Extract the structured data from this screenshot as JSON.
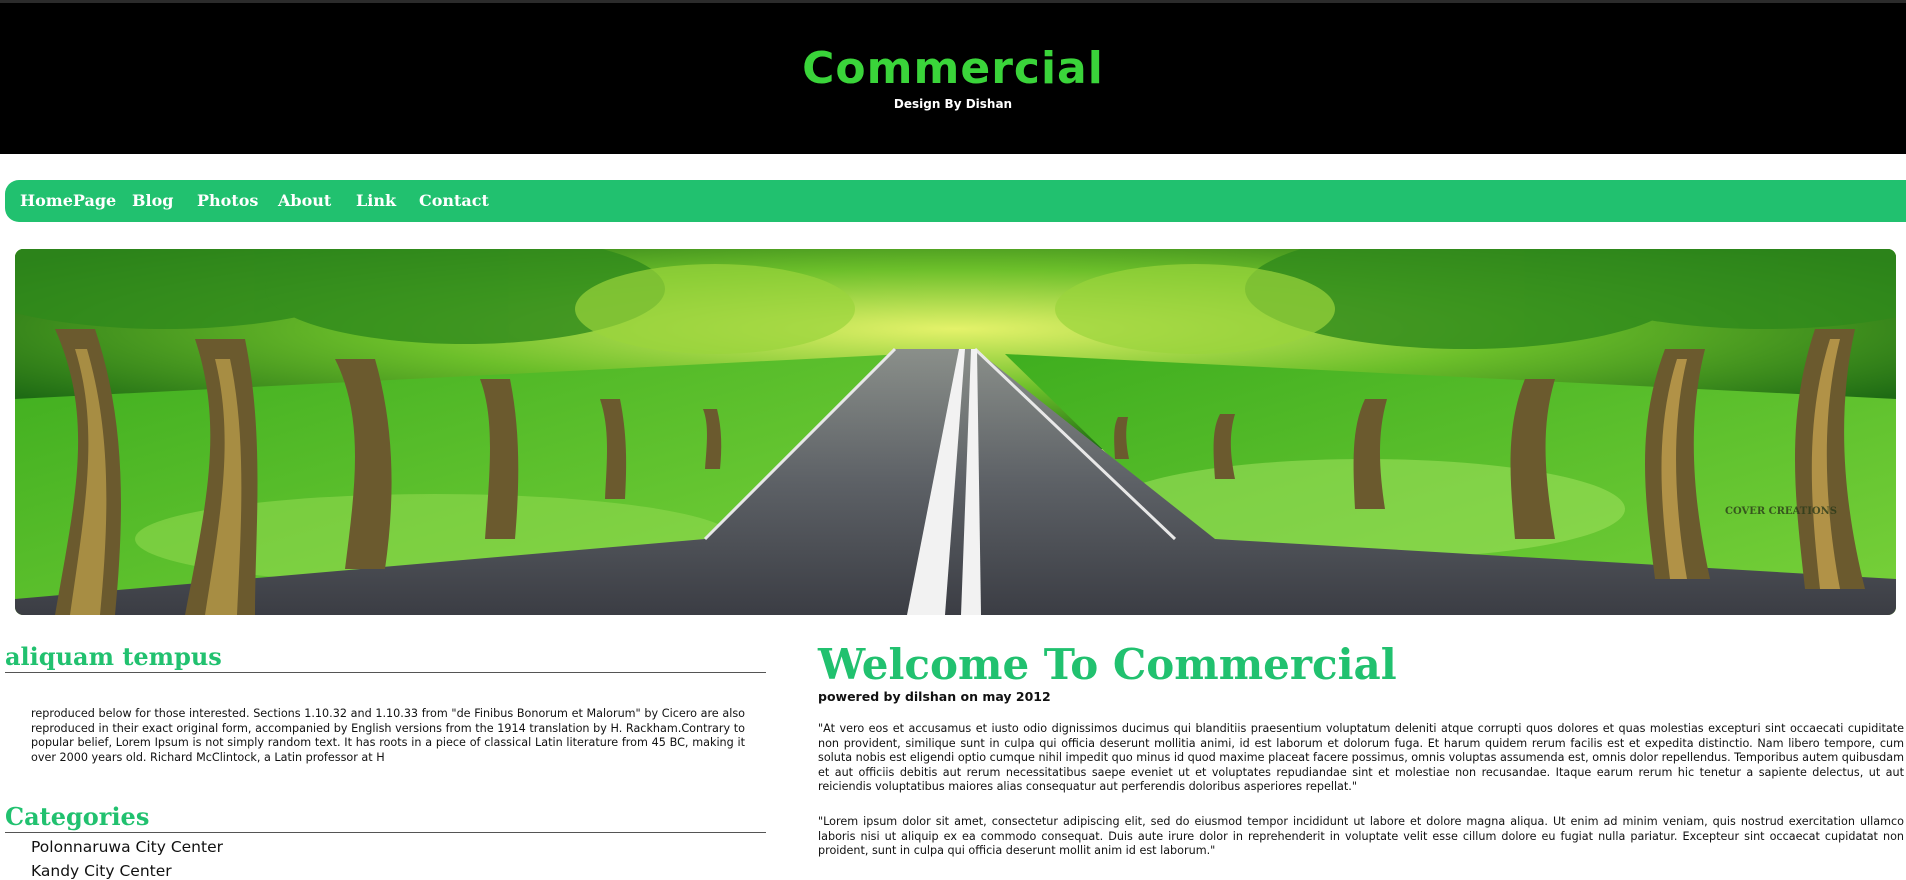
{
  "header": {
    "title": "Commercial",
    "subtitle": "Design By Dishan"
  },
  "nav": {
    "items": [
      {
        "label": "HomePage"
      },
      {
        "label": "Blog"
      },
      {
        "label": "Photos"
      },
      {
        "label": "About"
      },
      {
        "label": "Link"
      },
      {
        "label": "Contact"
      }
    ]
  },
  "banner": {
    "watermark": "COVER CREATIONS"
  },
  "sidebar": {
    "section1": {
      "title": "aliquam tempus",
      "text": "reproduced below for those interested. Sections 1.10.32 and 1.10.33 from \"de Finibus Bonorum et Malorum\" by Cicero are also reproduced in their exact original form, accompanied by English versions from the 1914 translation by H. Rackham.Contrary to popular belief, Lorem Ipsum is not simply random text. It has roots in a piece of classical Latin literature from 45 BC, making it over 2000 years old. Richard McClintock, a Latin professor at H"
    },
    "categories": {
      "title": "Categories",
      "items": [
        "Polonnaruwa City Center",
        "Kandy City Center"
      ]
    }
  },
  "main": {
    "title": "Welcome To Commercial",
    "byline": "powered by dilshan on may 2012",
    "paragraphs": [
      "\"At vero eos et accusamus et iusto odio dignissimos ducimus qui blanditiis praesentium voluptatum deleniti atque corrupti quos dolores et quas molestias excepturi sint occaecati cupiditate non provident, similique sunt in culpa qui officia deserunt mollitia animi, id est laborum et dolorum fuga. Et harum quidem rerum facilis est et expedita distinctio. Nam libero tempore, cum soluta nobis est eligendi optio cumque nihil impedit quo minus id quod maxime placeat facere possimus, omnis voluptas assumenda est, omnis dolor repellendus. Temporibus autem quibusdam et aut officiis debitis aut rerum necessitatibus saepe eveniet ut et voluptates repudiandae sint et molestiae non recusandae. Itaque earum rerum hic tenetur a sapiente delectus, ut aut reiciendis voluptatibus maiores alias consequatur aut perferendis doloribus asperiores repellat.\"",
      "\"Lorem ipsum dolor sit amet, consectetur adipiscing elit, sed do eiusmod tempor incididunt ut labore et dolore magna aliqua. Ut enim ad minim veniam, quis nostrud exercitation ullamco laboris nisi ut aliquip ex ea commodo consequat. Duis aute irure dolor in reprehenderit in voluptate velit esse cillum dolore eu fugiat nulla pariatur. Excepteur sint occaecat cupidatat non proident, sunt in culpa qui officia deserunt mollit anim id est laborum.\""
    ]
  },
  "colors": {
    "accent": "#21c16f",
    "title_green": "#3ad43a",
    "header_bg": "#000000"
  }
}
